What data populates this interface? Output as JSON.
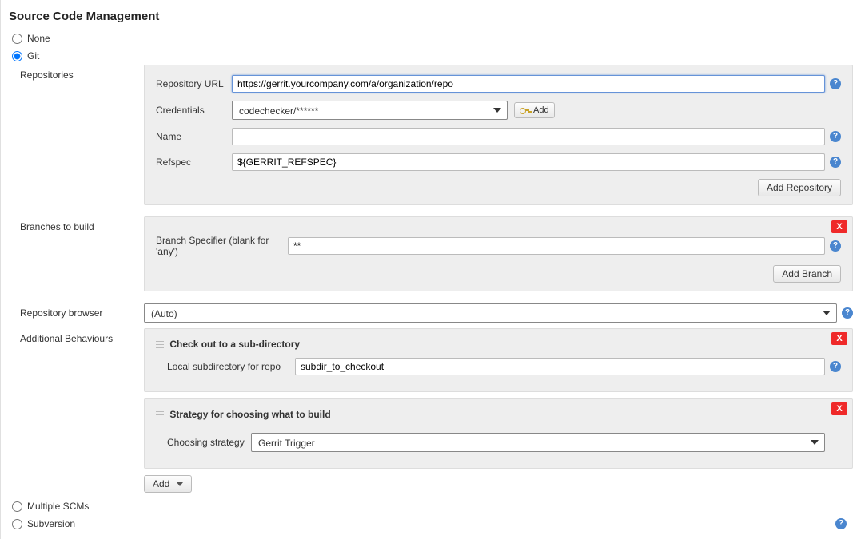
{
  "title": "Source Code Management",
  "scm_options": {
    "none": {
      "label": "None",
      "checked": false
    },
    "git": {
      "label": "Git",
      "checked": true
    },
    "multiple": {
      "label": "Multiple SCMs",
      "checked": false
    },
    "subversion": {
      "label": "Subversion",
      "checked": false
    }
  },
  "labels": {
    "repositories": "Repositories",
    "repository_url": "Repository URL",
    "credentials": "Credentials",
    "name": "Name",
    "refspec": "Refspec",
    "branches_to_build": "Branches to build",
    "branch_specifier": "Branch Specifier (blank for 'any')",
    "repository_browser": "Repository browser",
    "additional_behaviours": "Additional Behaviours",
    "checkout_subdir": "Check out to a sub-directory",
    "local_subdir": "Local subdirectory for repo",
    "strategy_heading": "Strategy for choosing what to build",
    "choosing_strategy": "Choosing strategy"
  },
  "values": {
    "repository_url": "https://gerrit.yourcompany.com/a/organization/repo",
    "credentials": "codechecker/******",
    "name": "",
    "refspec": "${GERRIT_REFSPEC}",
    "branch_specifier": "**",
    "repository_browser": "(Auto)",
    "local_subdir": "subdir_to_checkout",
    "choosing_strategy": "Gerrit Trigger"
  },
  "buttons": {
    "add_credential": "Add",
    "add_repository": "Add Repository",
    "add_branch": "Add Branch",
    "add_behaviour": "Add",
    "delete": "X"
  },
  "help_glyph": "?"
}
